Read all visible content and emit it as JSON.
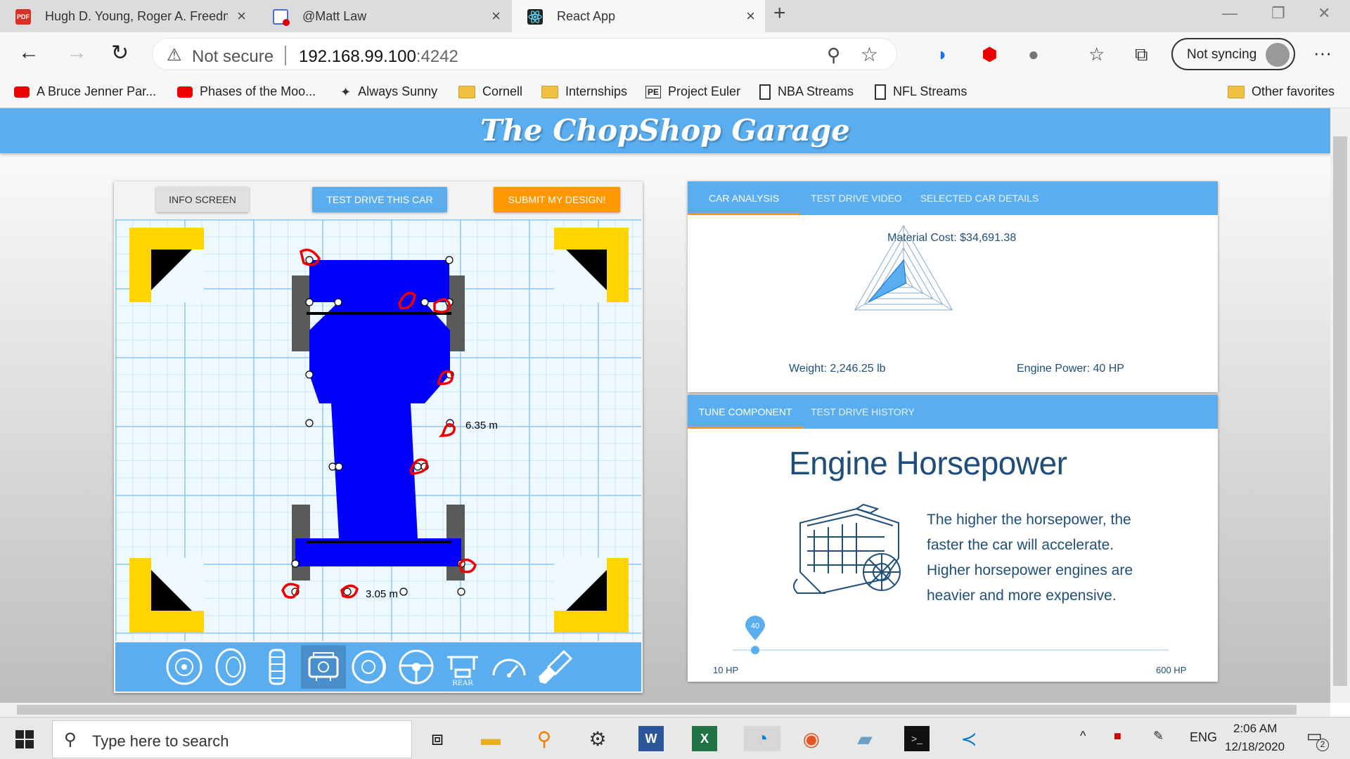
{
  "browser": {
    "tabs": [
      {
        "title": "Hugh D. Young, Roger A. Freedm",
        "icon": "pdf-icon"
      },
      {
        "title": "@Matt Law",
        "icon": "recording-icon"
      },
      {
        "title": "React App",
        "icon": "react-icon"
      }
    ],
    "security_label": "Not secure",
    "url_host": "192.168.99.100",
    "url_port": ":4242",
    "sync_label": "Not syncing",
    "bookmarks": [
      {
        "label": "A Bruce Jenner Par...",
        "icon": "youtube-icon"
      },
      {
        "label": "Phases of the Moo...",
        "icon": "youtube-icon"
      },
      {
        "label": "Always Sunny",
        "icon": "sunny-icon"
      },
      {
        "label": "Cornell",
        "icon": "folder-icon"
      },
      {
        "label": "Internships",
        "icon": "folder-icon"
      },
      {
        "label": "Project Euler",
        "icon": "euler-icon"
      },
      {
        "label": "NBA Streams",
        "icon": "page-icon"
      },
      {
        "label": "NFL Streams",
        "icon": "page-icon"
      }
    ],
    "other_favorites": "Other favorites"
  },
  "app": {
    "title": "The ChopShop Garage",
    "editor": {
      "info_button": "INFO SCREEN",
      "test_drive_button": "TEST DRIVE THIS CAR",
      "submit_button": "SUBMIT MY DESIGN!",
      "length_label": "6.35 m",
      "width_label": "3.05 m",
      "parts": [
        "wheel-icon",
        "tire-icon",
        "tread-icon",
        "engine-icon",
        "brake-icon",
        "steering-icon",
        "rear-wing-icon",
        "gauge-icon",
        "paint-icon"
      ],
      "rear_label": "REAR",
      "selected_part": "engine-icon"
    },
    "analysis": {
      "tabs": [
        "CAR ANALYSIS",
        "TEST DRIVE VIDEO",
        "SELECTED CAR DETAILS"
      ],
      "active_tab": 0,
      "material_cost": "Material Cost: $34,691.38",
      "weight": "Weight: 2,246.25 lb",
      "engine_power": "Engine Power: 40 HP",
      "radar_fractions": {
        "material_cost": 0.38,
        "weight": 0.72,
        "engine_power": 0.05
      }
    },
    "tune": {
      "tabs": [
        "TUNE COMPONENT",
        "TEST DRIVE HISTORY"
      ],
      "active_tab": 0,
      "heading": "Engine Horsepower",
      "description": "The higher the horsepower, the faster the car will accelerate. Higher horsepower engines are heavier and more expensive.",
      "slider": {
        "min": 10,
        "max": 600,
        "value": 40,
        "min_label": "10 HP",
        "max_label": "600 HP",
        "value_label": "40"
      }
    },
    "colors": {
      "header": "#5aaef0",
      "car_body": "#0000ff",
      "submit": "#ff9800",
      "accent": "#ff9800",
      "corner": "#ffd400"
    }
  },
  "taskbar": {
    "search_placeholder": "Type here to search",
    "language": "ENG",
    "time": "2:06 AM",
    "date": "12/18/2020",
    "notifications": "2"
  }
}
